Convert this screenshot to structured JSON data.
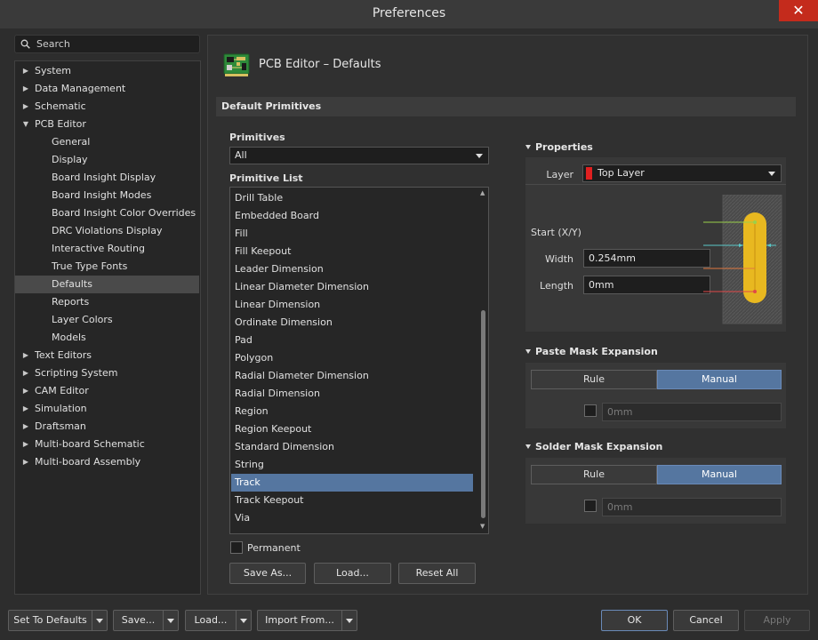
{
  "window": {
    "title": "Preferences",
    "close_glyph": "✕"
  },
  "search": {
    "label": "Search",
    "icon": "search-icon"
  },
  "tree": {
    "items": [
      {
        "label": "System",
        "level": 0,
        "expander": "▶"
      },
      {
        "label": "Data Management",
        "level": 0,
        "expander": "▶"
      },
      {
        "label": "Schematic",
        "level": 0,
        "expander": "▶"
      },
      {
        "label": "PCB Editor",
        "level": 0,
        "expander": "▼"
      },
      {
        "label": "General",
        "level": 1
      },
      {
        "label": "Display",
        "level": 1
      },
      {
        "label": "Board Insight Display",
        "level": 1
      },
      {
        "label": "Board Insight Modes",
        "level": 1
      },
      {
        "label": "Board Insight Color Overrides",
        "level": 1
      },
      {
        "label": "DRC Violations Display",
        "level": 1
      },
      {
        "label": "Interactive Routing",
        "level": 1
      },
      {
        "label": "True Type Fonts",
        "level": 1
      },
      {
        "label": "Defaults",
        "level": 1,
        "selected": true
      },
      {
        "label": "Reports",
        "level": 1
      },
      {
        "label": "Layer Colors",
        "level": 1
      },
      {
        "label": "Models",
        "level": 1
      },
      {
        "label": "Text Editors",
        "level": 0,
        "expander": "▶"
      },
      {
        "label": "Scripting System",
        "level": 0,
        "expander": "▶"
      },
      {
        "label": "CAM Editor",
        "level": 0,
        "expander": "▶"
      },
      {
        "label": "Simulation",
        "level": 0,
        "expander": "▶"
      },
      {
        "label": "Draftsman",
        "level": 0,
        "expander": "▶"
      },
      {
        "label": "Multi-board Schematic",
        "level": 0,
        "expander": "▶"
      },
      {
        "label": "Multi-board Assembly",
        "level": 0,
        "expander": "▶"
      }
    ]
  },
  "page": {
    "title": "PCB Editor – Defaults",
    "icon": "pcb-board-icon"
  },
  "section": {
    "title": "Default Primitives"
  },
  "primitives": {
    "label": "Primitives",
    "selected": "All",
    "list_label": "Primitive List",
    "items": [
      "Drill Table",
      "Embedded Board",
      "Fill",
      "Fill Keepout",
      "Leader Dimension",
      "Linear Diameter Dimension",
      "Linear Dimension",
      "Ordinate Dimension",
      "Pad",
      "Polygon",
      "Radial Diameter Dimension",
      "Radial Dimension",
      "Region",
      "Region Keepout",
      "Standard Dimension",
      "String",
      "Track",
      "Track Keepout",
      "Via"
    ],
    "selected_item": "Track",
    "permanent_label": "Permanent",
    "permanent_checked": false,
    "buttons": {
      "save_as": "Save As...",
      "load": "Load...",
      "reset_all": "Reset All"
    }
  },
  "properties": {
    "title": "Properties",
    "layer_label": "Layer",
    "layer_value": "Top Layer",
    "layer_color": "#e02020",
    "start_label": "Start (X/Y)",
    "width_label": "Width",
    "width_value": "0.254mm",
    "length_label": "Length",
    "length_value": "0mm"
  },
  "paste_mask": {
    "title": "Paste Mask Expansion",
    "rule_label": "Rule",
    "manual_label": "Manual",
    "active": "Manual",
    "value_placeholder": "0mm"
  },
  "solder_mask": {
    "title": "Solder Mask Expansion",
    "rule_label": "Rule",
    "manual_label": "Manual",
    "active": "Manual",
    "value_placeholder": "0mm"
  },
  "footer": {
    "set_to_defaults": "Set To Defaults",
    "save": "Save...",
    "load": "Load...",
    "import_from": "Import From...",
    "ok": "OK",
    "cancel": "Cancel",
    "apply": "Apply"
  },
  "colors": {
    "accent": "#5576a0",
    "close": "#c42b1c",
    "track": "#e8b820"
  }
}
